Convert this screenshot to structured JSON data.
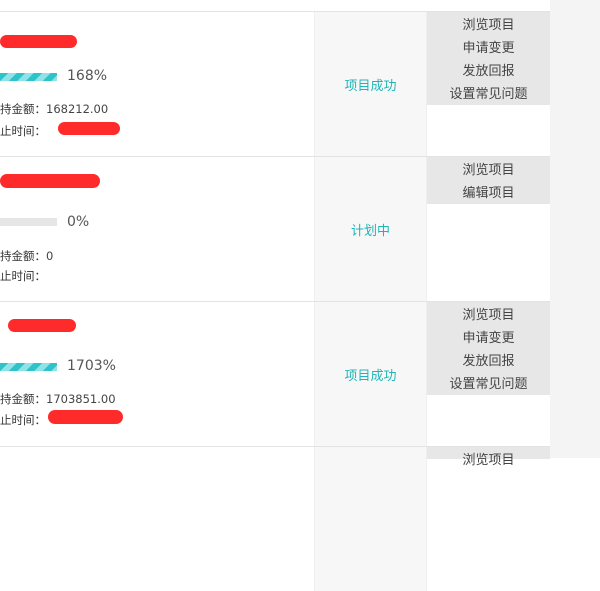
{
  "projects": [
    {
      "progress_pct": 168,
      "progress_text": "168%",
      "amount_label": "持金额：",
      "amount_value": "168212.00",
      "deadline_label": "止时间：",
      "status": "项目成功",
      "actions": [
        "浏览项目",
        "申请变更",
        "发放回报",
        "设置常见问题"
      ]
    },
    {
      "progress_pct": 0,
      "progress_text": "0%",
      "amount_label": "持金额：",
      "amount_value": "0",
      "deadline_label": "止时间：",
      "status": "计划中",
      "actions": [
        "浏览项目",
        "编辑项目"
      ]
    },
    {
      "progress_pct": 1703,
      "progress_text": "1703%",
      "amount_label": "持金额：",
      "amount_value": "1703851.00",
      "deadline_label": "止时间：",
      "status": "项目成功",
      "actions": [
        "浏览项目",
        "申请变更",
        "发放回报",
        "设置常见问题"
      ]
    },
    {
      "actions": [
        "浏览项目"
      ]
    }
  ],
  "colors": {
    "accent": "#1fb5b8",
    "redaction": "#ff2b2b",
    "actions_bg": "#e7e7e7"
  }
}
